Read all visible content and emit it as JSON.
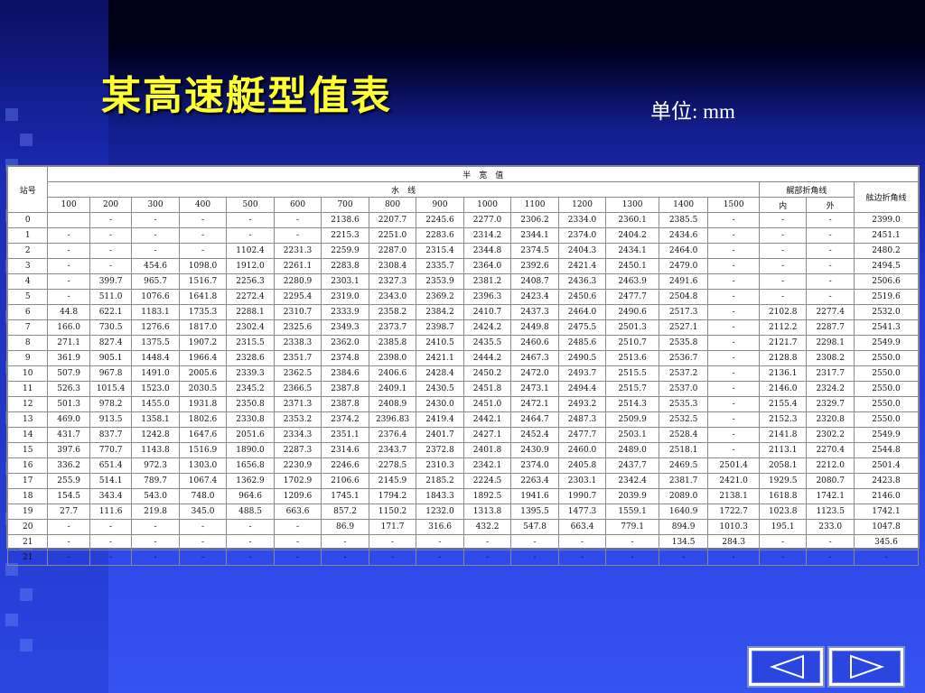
{
  "title": "某高速艇型值表",
  "unit": "单位: mm",
  "header": {
    "station": "站号",
    "half_breadth": "半　宽　值",
    "waterline": "水　线",
    "chine_group": "艉部折角线",
    "chine_inner": "内",
    "chine_outer": "外",
    "deck_edge": "舷边折角线",
    "wl_columns": [
      "100",
      "200",
      "300",
      "400",
      "500",
      "600",
      "700",
      "800",
      "900",
      "1000",
      "1100",
      "1200",
      "1300",
      "1400",
      "1500"
    ]
  },
  "rows": [
    [
      "0",
      "",
      "-",
      "-",
      "-",
      "-",
      "-",
      "2138.6",
      "2207.7",
      "2245.6",
      "2277.0",
      "2306.2",
      "2334.0",
      "2360.1",
      "2385.5",
      "-",
      "-",
      "-",
      "2399.0"
    ],
    [
      "1",
      "-",
      "-",
      "-",
      "-",
      "-",
      "-",
      "2215.3",
      "2251.0",
      "2283.6",
      "2314.2",
      "2344.1",
      "2374.0",
      "2404.2",
      "2434.6",
      "-",
      "-",
      "-",
      "2451.1"
    ],
    [
      "2",
      "-",
      "-",
      "-",
      "-",
      "1102.4",
      "2231.3",
      "2259.9",
      "2287.0",
      "2315.4",
      "2344.8",
      "2374.5",
      "2404.3",
      "2434.1",
      "2464.0",
      "-",
      "-",
      "-",
      "2480.2"
    ],
    [
      "3",
      "-",
      "-",
      "454.6",
      "1098.0",
      "1912.0",
      "2261.1",
      "2283.8",
      "2308.4",
      "2335.7",
      "2364.0",
      "2392.6",
      "2421.4",
      "2450.1",
      "2479.0",
      "-",
      "-",
      "-",
      "2494.5"
    ],
    [
      "4",
      "-",
      "399.7",
      "965.7",
      "1516.7",
      "2256.3",
      "2280.9",
      "2303.1",
      "2327.3",
      "2353.9",
      "2381.2",
      "2408.7",
      "2436.3",
      "2463.9",
      "2491.6",
      "-",
      "-",
      "-",
      "2506.6"
    ],
    [
      "5",
      "-",
      "511.0",
      "1076.6",
      "1641.8",
      "2272.4",
      "2295.4",
      "2319.0",
      "2343.0",
      "2369.2",
      "2396.3",
      "2423.4",
      "2450.6",
      "2477.7",
      "2504.8",
      "-",
      "-",
      "-",
      "2519.6"
    ],
    [
      "6",
      "44.8",
      "622.1",
      "1183.1",
      "1735.3",
      "2288.1",
      "2310.7",
      "2333.9",
      "2358.2",
      "2384.2",
      "2410.7",
      "2437.3",
      "2464.0",
      "2490.6",
      "2517.3",
      "-",
      "2102.8",
      "2277.4",
      "2532.0"
    ],
    [
      "7",
      "166.0",
      "730.5",
      "1276.6",
      "1817.0",
      "2302.4",
      "2325.6",
      "2349.3",
      "2373.7",
      "2398.7",
      "2424.2",
      "2449.8",
      "2475.5",
      "2501.3",
      "2527.1",
      "-",
      "2112.2",
      "2287.7",
      "2541.3"
    ],
    [
      "8",
      "271.1",
      "827.4",
      "1375.5",
      "1907.2",
      "2315.5",
      "2338.3",
      "2362.0",
      "2385.8",
      "2410.5",
      "2435.5",
      "2460.6",
      "2485.6",
      "2510.7",
      "2535.8",
      "-",
      "2121.7",
      "2298.1",
      "2549.9"
    ],
    [
      "9",
      "361.9",
      "905.1",
      "1448.4",
      "1966.4",
      "2328.6",
      "2351.7",
      "2374.8",
      "2398.0",
      "2421.1",
      "2444.2",
      "2467.3",
      "2490.5",
      "2513.6",
      "2536.7",
      "-",
      "2128.8",
      "2308.2",
      "2550.0"
    ],
    [
      "10",
      "507.9",
      "967.8",
      "1491.0",
      "2005.6",
      "2339.3",
      "2362.5",
      "2384.6",
      "2406.6",
      "2428.4",
      "2450.2",
      "2472.0",
      "2493.7",
      "2515.5",
      "2537.2",
      "-",
      "2136.1",
      "2317.7",
      "2550.0"
    ],
    [
      "11",
      "526.3",
      "1015.4",
      "1523.0",
      "2030.5",
      "2345.2",
      "2366.5",
      "2387.8",
      "2409.1",
      "2430.5",
      "2451.8",
      "2473.1",
      "2494.4",
      "2515.7",
      "2537.0",
      "-",
      "2146.0",
      "2324.2",
      "2550.0"
    ],
    [
      "12",
      "501.3",
      "978.2",
      "1455.0",
      "1931.8",
      "2350.8",
      "2371.3",
      "2387.8",
      "2408.9",
      "2430.0",
      "2451.0",
      "2472.1",
      "2493.2",
      "2514.3",
      "2535.3",
      "-",
      "2155.4",
      "2329.7",
      "2550.0"
    ],
    [
      "13",
      "469.0",
      "913.5",
      "1358.1",
      "1802.6",
      "2330.8",
      "2353.2",
      "2374.2",
      "2396.83",
      "2419.4",
      "2442.1",
      "2464.7",
      "2487.3",
      "2509.9",
      "2532.5",
      "-",
      "2152.3",
      "2320.8",
      "2550.0"
    ],
    [
      "14",
      "431.7",
      "837.7",
      "1242.8",
      "1647.6",
      "2051.6",
      "2334.3",
      "2351.1",
      "2376.4",
      "2401.7",
      "2427.1",
      "2452.4",
      "2477.7",
      "2503.1",
      "2528.4",
      "-",
      "2141.8",
      "2302.2",
      "2549.9"
    ],
    [
      "15",
      "397.6",
      "770.7",
      "1143.8",
      "1516.9",
      "1890.0",
      "2287.3",
      "2314.6",
      "2343.7",
      "2372.8",
      "2401.8",
      "2430.9",
      "2460.0",
      "2489.0",
      "2518.1",
      "-",
      "2113.1",
      "2270.4",
      "2544.8"
    ],
    [
      "16",
      "336.2",
      "651.4",
      "972.3",
      "1303.0",
      "1656.8",
      "2230.9",
      "2246.6",
      "2278.5",
      "2310.3",
      "2342.1",
      "2374.0",
      "2405.8",
      "2437.7",
      "2469.5",
      "2501.4",
      "2058.1",
      "2212.0",
      "2501.4"
    ],
    [
      "17",
      "255.9",
      "514.1",
      "789.7",
      "1067.4",
      "1362.9",
      "1702.9",
      "2106.6",
      "2145.9",
      "2185.2",
      "2224.5",
      "2263.4",
      "2303.1",
      "2342.4",
      "2381.7",
      "2421.0",
      "1929.5",
      "2080.7",
      "2423.8"
    ],
    [
      "18",
      "154.5",
      "343.4",
      "543.0",
      "748.0",
      "964.6",
      "1209.6",
      "1745.1",
      "1794.2",
      "1843.3",
      "1892.5",
      "1941.6",
      "1990.7",
      "2039.9",
      "2089.0",
      "2138.1",
      "1618.8",
      "1742.1",
      "2146.0"
    ],
    [
      "19",
      "27.7",
      "111.6",
      "219.8",
      "345.0",
      "488.5",
      "663.6",
      "857.2",
      "1150.2",
      "1232.0",
      "1313.8",
      "1395.5",
      "1477.3",
      "1559.1",
      "1640.9",
      "1722.7",
      "1023.8",
      "1123.5",
      "1742.1"
    ],
    [
      "20",
      "-",
      "-",
      "-",
      "-",
      "-",
      "-",
      "86.9",
      "171.7",
      "316.6",
      "432.2",
      "547.8",
      "663.4",
      "779.1",
      "894.9",
      "1010.3",
      "195.1",
      "233.0",
      "1047.8"
    ],
    [
      "21",
      "-",
      "-",
      "-",
      "-",
      "-",
      "-",
      "-",
      "-",
      "-",
      "-",
      "-",
      "-",
      "-",
      "134.5",
      "284.3",
      "-",
      "-",
      "345.6"
    ],
    [
      "21",
      "-",
      "-",
      "-",
      "-",
      "-",
      "-",
      "-",
      "-",
      "-",
      "-",
      "-",
      "-",
      "-",
      "-",
      "-",
      "-",
      "-",
      "-"
    ]
  ],
  "nav": {
    "prev_icon": "triangle-left-icon",
    "next_icon": "triangle-right-icon"
  },
  "colors": {
    "title": "#ffff33",
    "background": "#2a45e0"
  }
}
